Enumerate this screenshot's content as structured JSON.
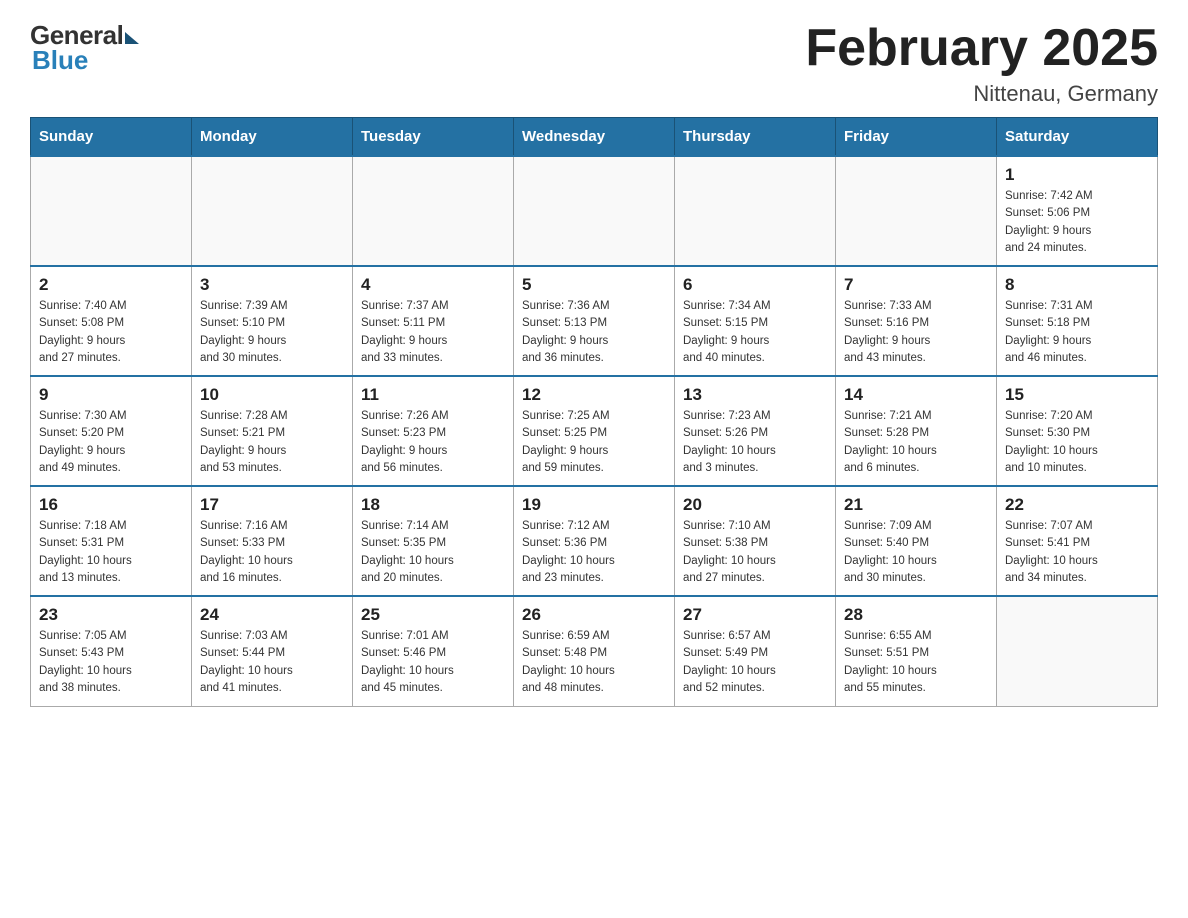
{
  "header": {
    "logo_general": "General",
    "logo_blue": "Blue",
    "month_title": "February 2025",
    "location": "Nittenau, Germany"
  },
  "weekdays": [
    "Sunday",
    "Monday",
    "Tuesday",
    "Wednesday",
    "Thursday",
    "Friday",
    "Saturday"
  ],
  "weeks": [
    [
      {
        "day": "",
        "info": ""
      },
      {
        "day": "",
        "info": ""
      },
      {
        "day": "",
        "info": ""
      },
      {
        "day": "",
        "info": ""
      },
      {
        "day": "",
        "info": ""
      },
      {
        "day": "",
        "info": ""
      },
      {
        "day": "1",
        "info": "Sunrise: 7:42 AM\nSunset: 5:06 PM\nDaylight: 9 hours\nand 24 minutes."
      }
    ],
    [
      {
        "day": "2",
        "info": "Sunrise: 7:40 AM\nSunset: 5:08 PM\nDaylight: 9 hours\nand 27 minutes."
      },
      {
        "day": "3",
        "info": "Sunrise: 7:39 AM\nSunset: 5:10 PM\nDaylight: 9 hours\nand 30 minutes."
      },
      {
        "day": "4",
        "info": "Sunrise: 7:37 AM\nSunset: 5:11 PM\nDaylight: 9 hours\nand 33 minutes."
      },
      {
        "day": "5",
        "info": "Sunrise: 7:36 AM\nSunset: 5:13 PM\nDaylight: 9 hours\nand 36 minutes."
      },
      {
        "day": "6",
        "info": "Sunrise: 7:34 AM\nSunset: 5:15 PM\nDaylight: 9 hours\nand 40 minutes."
      },
      {
        "day": "7",
        "info": "Sunrise: 7:33 AM\nSunset: 5:16 PM\nDaylight: 9 hours\nand 43 minutes."
      },
      {
        "day": "8",
        "info": "Sunrise: 7:31 AM\nSunset: 5:18 PM\nDaylight: 9 hours\nand 46 minutes."
      }
    ],
    [
      {
        "day": "9",
        "info": "Sunrise: 7:30 AM\nSunset: 5:20 PM\nDaylight: 9 hours\nand 49 minutes."
      },
      {
        "day": "10",
        "info": "Sunrise: 7:28 AM\nSunset: 5:21 PM\nDaylight: 9 hours\nand 53 minutes."
      },
      {
        "day": "11",
        "info": "Sunrise: 7:26 AM\nSunset: 5:23 PM\nDaylight: 9 hours\nand 56 minutes."
      },
      {
        "day": "12",
        "info": "Sunrise: 7:25 AM\nSunset: 5:25 PM\nDaylight: 9 hours\nand 59 minutes."
      },
      {
        "day": "13",
        "info": "Sunrise: 7:23 AM\nSunset: 5:26 PM\nDaylight: 10 hours\nand 3 minutes."
      },
      {
        "day": "14",
        "info": "Sunrise: 7:21 AM\nSunset: 5:28 PM\nDaylight: 10 hours\nand 6 minutes."
      },
      {
        "day": "15",
        "info": "Sunrise: 7:20 AM\nSunset: 5:30 PM\nDaylight: 10 hours\nand 10 minutes."
      }
    ],
    [
      {
        "day": "16",
        "info": "Sunrise: 7:18 AM\nSunset: 5:31 PM\nDaylight: 10 hours\nand 13 minutes."
      },
      {
        "day": "17",
        "info": "Sunrise: 7:16 AM\nSunset: 5:33 PM\nDaylight: 10 hours\nand 16 minutes."
      },
      {
        "day": "18",
        "info": "Sunrise: 7:14 AM\nSunset: 5:35 PM\nDaylight: 10 hours\nand 20 minutes."
      },
      {
        "day": "19",
        "info": "Sunrise: 7:12 AM\nSunset: 5:36 PM\nDaylight: 10 hours\nand 23 minutes."
      },
      {
        "day": "20",
        "info": "Sunrise: 7:10 AM\nSunset: 5:38 PM\nDaylight: 10 hours\nand 27 minutes."
      },
      {
        "day": "21",
        "info": "Sunrise: 7:09 AM\nSunset: 5:40 PM\nDaylight: 10 hours\nand 30 minutes."
      },
      {
        "day": "22",
        "info": "Sunrise: 7:07 AM\nSunset: 5:41 PM\nDaylight: 10 hours\nand 34 minutes."
      }
    ],
    [
      {
        "day": "23",
        "info": "Sunrise: 7:05 AM\nSunset: 5:43 PM\nDaylight: 10 hours\nand 38 minutes."
      },
      {
        "day": "24",
        "info": "Sunrise: 7:03 AM\nSunset: 5:44 PM\nDaylight: 10 hours\nand 41 minutes."
      },
      {
        "day": "25",
        "info": "Sunrise: 7:01 AM\nSunset: 5:46 PM\nDaylight: 10 hours\nand 45 minutes."
      },
      {
        "day": "26",
        "info": "Sunrise: 6:59 AM\nSunset: 5:48 PM\nDaylight: 10 hours\nand 48 minutes."
      },
      {
        "day": "27",
        "info": "Sunrise: 6:57 AM\nSunset: 5:49 PM\nDaylight: 10 hours\nand 52 minutes."
      },
      {
        "day": "28",
        "info": "Sunrise: 6:55 AM\nSunset: 5:51 PM\nDaylight: 10 hours\nand 55 minutes."
      },
      {
        "day": "",
        "info": ""
      }
    ]
  ]
}
